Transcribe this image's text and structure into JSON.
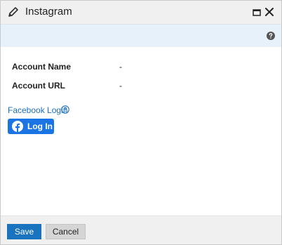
{
  "dialog": {
    "title": "Instagram",
    "title_icon": "pencil-icon",
    "window_icons": [
      "maximize-icon",
      "close-icon"
    ],
    "help_icon": "question-circle-icon"
  },
  "fields": [
    {
      "label": "Account Name",
      "value": "-"
    },
    {
      "label": "Account URL",
      "value": "-"
    }
  ],
  "facebook": {
    "login_label": "Facebook Login",
    "help_icon": "question-outline-icon",
    "button_label": "Log In",
    "button_icon": "facebook-logo-icon",
    "button_color": "#1b74e4"
  },
  "footer": {
    "save_label": "Save",
    "cancel_label": "Cancel"
  },
  "colors": {
    "primary": "#1a73be",
    "infobar": "#e7f1f9",
    "link": "#1c6fb8"
  }
}
